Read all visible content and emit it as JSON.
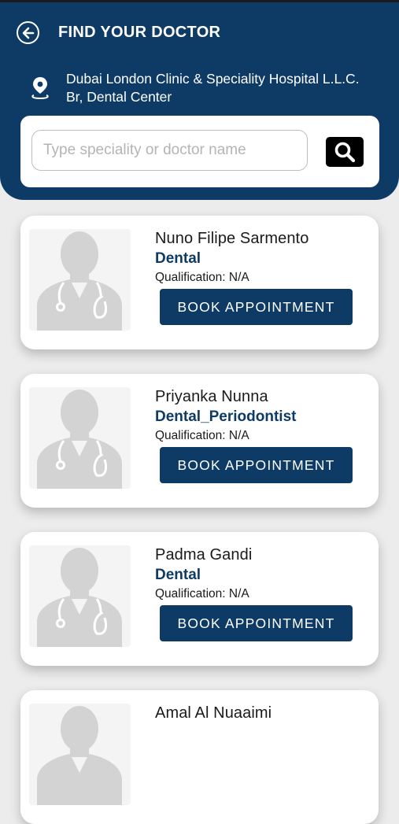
{
  "header": {
    "title": "FIND YOUR DOCTOR",
    "clinic_line1": "Dubai London Clinic & Speciality Hospital L.L.C.",
    "clinic_line2": "Br, Dental Center"
  },
  "search": {
    "placeholder": "Type speciality or doctor name",
    "value": ""
  },
  "colors": {
    "brand": "#0d3b66",
    "search_button": "#000000",
    "card_bg": "#ffffff"
  },
  "doctors": [
    {
      "name": "Nuno Filipe Sarmento",
      "speciality": "Dental",
      "qualification": "Qualification: N/A",
      "button_label": "BOOK APPOINTMENT"
    },
    {
      "name": "Priyanka Nunna",
      "speciality": "Dental_Periodontist",
      "qualification": "Qualification: N/A",
      "button_label": "BOOK APPOINTMENT"
    },
    {
      "name": "Padma Gandi",
      "speciality": "Dental",
      "qualification": "Qualification: N/A",
      "button_label": "BOOK APPOINTMENT"
    },
    {
      "name": "Amal Al Nuaaimi",
      "speciality": "",
      "qualification": "",
      "button_label": ""
    }
  ],
  "icons": {
    "back": "arrow-left-circle-icon",
    "location": "location-pin-icon",
    "search": "search-icon",
    "avatar": "doctor-placeholder-icon"
  }
}
